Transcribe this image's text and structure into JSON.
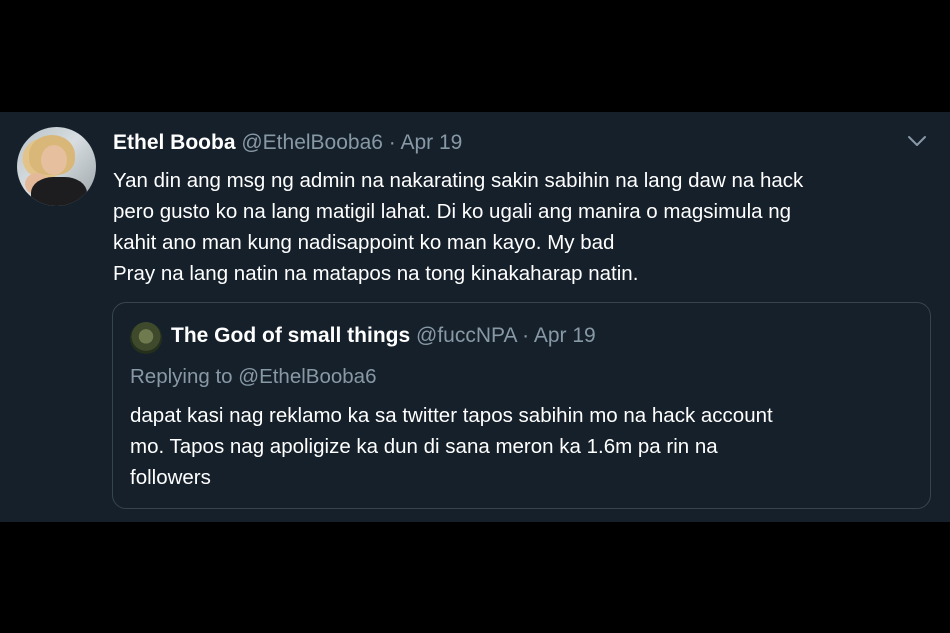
{
  "tweet": {
    "author_name": "Ethel Booba",
    "author_handle": "@EthelBooba6",
    "separator": "·",
    "date": "Apr 19",
    "text_lines": [
      "Yan din ang  msg ng admin na nakarating sakin sabihin na lang daw na hack",
      "pero gusto ko na lang matigil lahat. Di ko ugali ang manira o magsimula ng",
      "kahit ano man kung nadisappoint ko man kayo. My bad",
      "Pray na lang natin na matapos na tong kinakaharap natin."
    ],
    "menu_icon": "chevron-down-icon"
  },
  "quoted_tweet": {
    "author_name": "The God of small things",
    "author_handle": "@fuccNPA",
    "separator": "·",
    "date": "Apr 19",
    "replying_to": "Replying to @EthelBooba6",
    "text_lines": [
      "dapat kasi nag reklamo ka sa twitter tapos sabihin mo na hack account",
      "mo. Tapos nag apoligize ka dun di sana meron ka 1.6m pa rin na",
      "followers"
    ]
  },
  "colors": {
    "card_background": "#15202b",
    "page_background": "#000000",
    "primary_text": "#ffffff",
    "secondary_text": "#8899a6",
    "border": "#38444d"
  }
}
